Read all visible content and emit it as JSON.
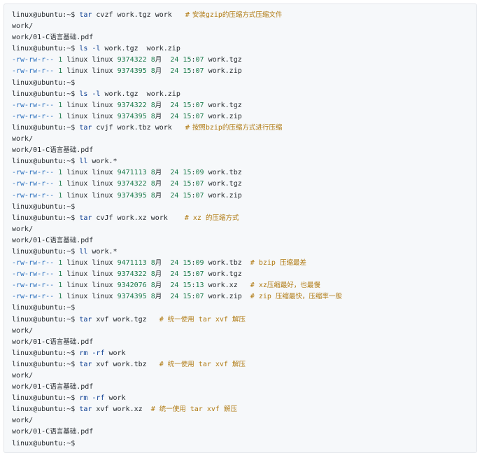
{
  "terminal": {
    "lines": [
      {
        "segments": [
          {
            "t": "linux@ubuntu:~$ "
          },
          {
            "t": "tar",
            "c": "kw"
          },
          {
            "t": " cvzf work.tgz work   "
          },
          {
            "t": "# 安装",
            "c": "cm cm-text"
          },
          {
            "t": "gzip",
            "c": "cm"
          },
          {
            "t": "的压缩方式压缩文件",
            "c": "cm cm-text"
          }
        ]
      },
      {
        "segments": [
          {
            "t": "work/"
          }
        ]
      },
      {
        "segments": [
          {
            "t": "work/01-C"
          },
          {
            "t": "语言基础",
            "c": "cjk"
          },
          {
            "t": ".pdf"
          }
        ]
      },
      {
        "segments": [
          {
            "t": "linux@ubuntu:~$ "
          },
          {
            "t": "ls",
            "c": "kw"
          },
          {
            "t": " "
          },
          {
            "t": "-l",
            "c": "kw"
          },
          {
            "t": " work.tgz  work.zip"
          }
        ]
      },
      {
        "segments": [
          {
            "t": "-rw-rw-r--",
            "c": "perm"
          },
          {
            "t": " "
          },
          {
            "t": "1",
            "c": "num"
          },
          {
            "t": " linux linux "
          },
          {
            "t": "9374322",
            "c": "num"
          },
          {
            "t": " "
          },
          {
            "t": "8",
            "c": "num"
          },
          {
            "t": "月",
            "c": "cjk"
          },
          {
            "t": "  "
          },
          {
            "t": "24",
            "c": "num"
          },
          {
            "t": " "
          },
          {
            "t": "15",
            "c": "num"
          },
          {
            "t": ":"
          },
          {
            "t": "07",
            "c": "num"
          },
          {
            "t": " work.tgz"
          }
        ]
      },
      {
        "segments": [
          {
            "t": "-rw-rw-r--",
            "c": "perm"
          },
          {
            "t": " "
          },
          {
            "t": "1",
            "c": "num"
          },
          {
            "t": " linux linux "
          },
          {
            "t": "9374395",
            "c": "num"
          },
          {
            "t": " "
          },
          {
            "t": "8",
            "c": "num"
          },
          {
            "t": "月",
            "c": "cjk"
          },
          {
            "t": "  "
          },
          {
            "t": "24",
            "c": "num"
          },
          {
            "t": " "
          },
          {
            "t": "15",
            "c": "num"
          },
          {
            "t": ":"
          },
          {
            "t": "07",
            "c": "num"
          },
          {
            "t": " work.zip"
          }
        ]
      },
      {
        "segments": [
          {
            "t": "linux@ubuntu:~$"
          }
        ]
      },
      {
        "segments": [
          {
            "t": "linux@ubuntu:~$ "
          },
          {
            "t": "ls",
            "c": "kw"
          },
          {
            "t": " "
          },
          {
            "t": "-l",
            "c": "kw"
          },
          {
            "t": " work.tgz  work.zip"
          }
        ]
      },
      {
        "segments": [
          {
            "t": "-rw-rw-r--",
            "c": "perm"
          },
          {
            "t": " "
          },
          {
            "t": "1",
            "c": "num"
          },
          {
            "t": " linux linux "
          },
          {
            "t": "9374322",
            "c": "num"
          },
          {
            "t": " "
          },
          {
            "t": "8",
            "c": "num"
          },
          {
            "t": "月",
            "c": "cjk"
          },
          {
            "t": "  "
          },
          {
            "t": "24",
            "c": "num"
          },
          {
            "t": " "
          },
          {
            "t": "15",
            "c": "num"
          },
          {
            "t": ":"
          },
          {
            "t": "07",
            "c": "num"
          },
          {
            "t": " work.tgz"
          }
        ]
      },
      {
        "segments": [
          {
            "t": "-rw-rw-r--",
            "c": "perm"
          },
          {
            "t": " "
          },
          {
            "t": "1",
            "c": "num"
          },
          {
            "t": " linux linux "
          },
          {
            "t": "9374395",
            "c": "num"
          },
          {
            "t": " "
          },
          {
            "t": "8",
            "c": "num"
          },
          {
            "t": "月",
            "c": "cjk"
          },
          {
            "t": "  "
          },
          {
            "t": "24",
            "c": "num"
          },
          {
            "t": " "
          },
          {
            "t": "15",
            "c": "num"
          },
          {
            "t": ":"
          },
          {
            "t": "07",
            "c": "num"
          },
          {
            "t": " work.zip"
          }
        ]
      },
      {
        "segments": [
          {
            "t": "linux@ubuntu:~$ "
          },
          {
            "t": "tar",
            "c": "kw"
          },
          {
            "t": " cvjf work.tbz work   "
          },
          {
            "t": "# 按照",
            "c": "cm cm-text"
          },
          {
            "t": "bzip",
            "c": "cm"
          },
          {
            "t": "的压缩方式进行压缩",
            "c": "cm cm-text"
          }
        ]
      },
      {
        "segments": [
          {
            "t": "work/"
          }
        ]
      },
      {
        "segments": [
          {
            "t": "work/01-C"
          },
          {
            "t": "语言基础",
            "c": "cjk"
          },
          {
            "t": ".pdf"
          }
        ]
      },
      {
        "segments": [
          {
            "t": "linux@ubuntu:~$ "
          },
          {
            "t": "ll",
            "c": "kw"
          },
          {
            "t": " work.*"
          }
        ]
      },
      {
        "segments": [
          {
            "t": "-rw-rw-r--",
            "c": "perm"
          },
          {
            "t": " "
          },
          {
            "t": "1",
            "c": "num"
          },
          {
            "t": " linux linux "
          },
          {
            "t": "9471113",
            "c": "num"
          },
          {
            "t": " "
          },
          {
            "t": "8",
            "c": "num"
          },
          {
            "t": "月",
            "c": "cjk"
          },
          {
            "t": "  "
          },
          {
            "t": "24",
            "c": "num"
          },
          {
            "t": " "
          },
          {
            "t": "15",
            "c": "num"
          },
          {
            "t": ":"
          },
          {
            "t": "09",
            "c": "num"
          },
          {
            "t": " work.tbz"
          }
        ]
      },
      {
        "segments": [
          {
            "t": "-rw-rw-r--",
            "c": "perm"
          },
          {
            "t": " "
          },
          {
            "t": "1",
            "c": "num"
          },
          {
            "t": " linux linux "
          },
          {
            "t": "9374322",
            "c": "num"
          },
          {
            "t": " "
          },
          {
            "t": "8",
            "c": "num"
          },
          {
            "t": "月",
            "c": "cjk"
          },
          {
            "t": "  "
          },
          {
            "t": "24",
            "c": "num"
          },
          {
            "t": " "
          },
          {
            "t": "15",
            "c": "num"
          },
          {
            "t": ":"
          },
          {
            "t": "07",
            "c": "num"
          },
          {
            "t": " work.tgz"
          }
        ]
      },
      {
        "segments": [
          {
            "t": "-rw-rw-r--",
            "c": "perm"
          },
          {
            "t": " "
          },
          {
            "t": "1",
            "c": "num"
          },
          {
            "t": " linux linux "
          },
          {
            "t": "9374395",
            "c": "num"
          },
          {
            "t": " "
          },
          {
            "t": "8",
            "c": "num"
          },
          {
            "t": "月",
            "c": "cjk"
          },
          {
            "t": "  "
          },
          {
            "t": "24",
            "c": "num"
          },
          {
            "t": " "
          },
          {
            "t": "15",
            "c": "num"
          },
          {
            "t": ":"
          },
          {
            "t": "07",
            "c": "num"
          },
          {
            "t": " work.zip"
          }
        ]
      },
      {
        "segments": [
          {
            "t": "linux@ubuntu:~$"
          }
        ]
      },
      {
        "segments": [
          {
            "t": "linux@ubuntu:~$ "
          },
          {
            "t": "tar",
            "c": "kw"
          },
          {
            "t": " cvJf work.xz work    "
          },
          {
            "t": "# xz ",
            "c": "cm"
          },
          {
            "t": "的压缩方式",
            "c": "cm cm-text"
          }
        ]
      },
      {
        "segments": [
          {
            "t": "work/"
          }
        ]
      },
      {
        "segments": [
          {
            "t": "work/01-C"
          },
          {
            "t": "语言基础",
            "c": "cjk"
          },
          {
            "t": ".pdf"
          }
        ]
      },
      {
        "segments": [
          {
            "t": "linux@ubuntu:~$ "
          },
          {
            "t": "ll",
            "c": "kw"
          },
          {
            "t": " work.*"
          }
        ]
      },
      {
        "segments": [
          {
            "t": "-rw-rw-r--",
            "c": "perm"
          },
          {
            "t": " "
          },
          {
            "t": "1",
            "c": "num"
          },
          {
            "t": " linux linux "
          },
          {
            "t": "9471113",
            "c": "num"
          },
          {
            "t": " "
          },
          {
            "t": "8",
            "c": "num"
          },
          {
            "t": "月",
            "c": "cjk"
          },
          {
            "t": "  "
          },
          {
            "t": "24",
            "c": "num"
          },
          {
            "t": " "
          },
          {
            "t": "15",
            "c": "num"
          },
          {
            "t": ":"
          },
          {
            "t": "09",
            "c": "num"
          },
          {
            "t": " work.tbz  "
          },
          {
            "t": "# bzip ",
            "c": "cm"
          },
          {
            "t": "压缩最差",
            "c": "cm cm-text"
          }
        ]
      },
      {
        "segments": [
          {
            "t": "-rw-rw-r--",
            "c": "perm"
          },
          {
            "t": " "
          },
          {
            "t": "1",
            "c": "num"
          },
          {
            "t": " linux linux "
          },
          {
            "t": "9374322",
            "c": "num"
          },
          {
            "t": " "
          },
          {
            "t": "8",
            "c": "num"
          },
          {
            "t": "月",
            "c": "cjk"
          },
          {
            "t": "  "
          },
          {
            "t": "24",
            "c": "num"
          },
          {
            "t": " "
          },
          {
            "t": "15",
            "c": "num"
          },
          {
            "t": ":"
          },
          {
            "t": "07",
            "c": "num"
          },
          {
            "t": " work.tgz"
          }
        ]
      },
      {
        "segments": [
          {
            "t": "-rw-rw-r--",
            "c": "perm"
          },
          {
            "t": " "
          },
          {
            "t": "1",
            "c": "num"
          },
          {
            "t": " linux linux "
          },
          {
            "t": "9342076",
            "c": "num"
          },
          {
            "t": " "
          },
          {
            "t": "8",
            "c": "num"
          },
          {
            "t": "月",
            "c": "cjk"
          },
          {
            "t": "  "
          },
          {
            "t": "24",
            "c": "num"
          },
          {
            "t": " "
          },
          {
            "t": "15",
            "c": "num"
          },
          {
            "t": ":"
          },
          {
            "t": "13",
            "c": "num"
          },
          {
            "t": " work.xz   "
          },
          {
            "t": "# xz",
            "c": "cm"
          },
          {
            "t": "压缩最好，也最慢",
            "c": "cm cm-text"
          }
        ]
      },
      {
        "segments": [
          {
            "t": "-rw-rw-r--",
            "c": "perm"
          },
          {
            "t": " "
          },
          {
            "t": "1",
            "c": "num"
          },
          {
            "t": " linux linux "
          },
          {
            "t": "9374395",
            "c": "num"
          },
          {
            "t": " "
          },
          {
            "t": "8",
            "c": "num"
          },
          {
            "t": "月",
            "c": "cjk"
          },
          {
            "t": "  "
          },
          {
            "t": "24",
            "c": "num"
          },
          {
            "t": " "
          },
          {
            "t": "15",
            "c": "num"
          },
          {
            "t": ":"
          },
          {
            "t": "07",
            "c": "num"
          },
          {
            "t": " work.zip  "
          },
          {
            "t": "# zip ",
            "c": "cm"
          },
          {
            "t": "压缩最快，压缩率一般",
            "c": "cm cm-text"
          }
        ]
      },
      {
        "segments": [
          {
            "t": "linux@ubuntu:~$"
          }
        ]
      },
      {
        "segments": [
          {
            "t": "linux@ubuntu:~$ "
          },
          {
            "t": "tar",
            "c": "kw"
          },
          {
            "t": " xvf work.tgz   "
          },
          {
            "t": "# ",
            "c": "cm"
          },
          {
            "t": "统一使用",
            "c": "cm cm-text"
          },
          {
            "t": " tar xvf ",
            "c": "cm"
          },
          {
            "t": "解压",
            "c": "cm cm-text"
          }
        ]
      },
      {
        "segments": [
          {
            "t": "work/"
          }
        ]
      },
      {
        "segments": [
          {
            "t": "work/01-C"
          },
          {
            "t": "语言基础",
            "c": "cjk"
          },
          {
            "t": ".pdf"
          }
        ]
      },
      {
        "segments": [
          {
            "t": "linux@ubuntu:~$ "
          },
          {
            "t": "rm",
            "c": "kw"
          },
          {
            "t": " "
          },
          {
            "t": "-rf",
            "c": "kw"
          },
          {
            "t": " work"
          }
        ]
      },
      {
        "segments": [
          {
            "t": "linux@ubuntu:~$ "
          },
          {
            "t": "tar",
            "c": "kw"
          },
          {
            "t": " xvf work.tbz   "
          },
          {
            "t": "# ",
            "c": "cm"
          },
          {
            "t": "统一使用",
            "c": "cm cm-text"
          },
          {
            "t": " tar xvf ",
            "c": "cm"
          },
          {
            "t": "解压",
            "c": "cm cm-text"
          }
        ]
      },
      {
        "segments": [
          {
            "t": "work/"
          }
        ]
      },
      {
        "segments": [
          {
            "t": "work/01-C"
          },
          {
            "t": "语言基础",
            "c": "cjk"
          },
          {
            "t": ".pdf"
          }
        ]
      },
      {
        "segments": [
          {
            "t": "linux@ubuntu:~$ "
          },
          {
            "t": "rm",
            "c": "kw"
          },
          {
            "t": " "
          },
          {
            "t": "-rf",
            "c": "kw"
          },
          {
            "t": " work"
          }
        ]
      },
      {
        "segments": [
          {
            "t": "linux@ubuntu:~$ "
          },
          {
            "t": "tar",
            "c": "kw"
          },
          {
            "t": " xvf work.xz  "
          },
          {
            "t": "# ",
            "c": "cm"
          },
          {
            "t": "统一使用",
            "c": "cm cm-text"
          },
          {
            "t": " tar xvf ",
            "c": "cm"
          },
          {
            "t": "解压",
            "c": "cm cm-text"
          }
        ]
      },
      {
        "segments": [
          {
            "t": "work/"
          }
        ]
      },
      {
        "segments": [
          {
            "t": "work/01-C"
          },
          {
            "t": "语言基础",
            "c": "cjk"
          },
          {
            "t": ".pdf"
          }
        ]
      },
      {
        "segments": [
          {
            "t": "linux@ubuntu:~$"
          }
        ]
      }
    ]
  },
  "colors": {
    "background": "#f6f8fa",
    "text": "#24292e",
    "keyword": "#0b3d91",
    "comment": "#b07a12",
    "permission": "#2a6fbe",
    "number": "#1a7a4a"
  }
}
